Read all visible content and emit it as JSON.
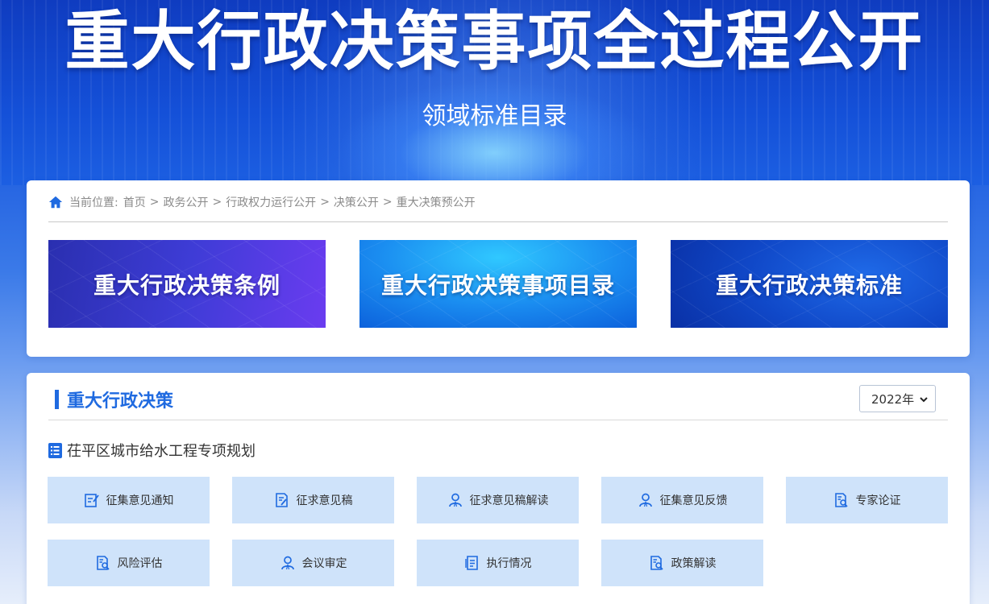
{
  "banner": {
    "title": "重大行政决策事项全过程公开",
    "subtitle": "领域标准目录"
  },
  "breadcrumb": {
    "prefix": "当前位置:",
    "items": [
      "首页",
      "政务公开",
      "行政权力运行公开",
      "决策公开",
      "重大决策预公开"
    ],
    "separator": ">"
  },
  "tiles": [
    {
      "label": "重大行政决策条例"
    },
    {
      "label": "重大行政决策事项目录"
    },
    {
      "label": "重大行政决策标准"
    }
  ],
  "section": {
    "title": "重大行政决策",
    "year_select": {
      "value": "2022年"
    },
    "item_title": "茌平区城市给水工程专项规划",
    "buttons": [
      {
        "label": "征集意见通知",
        "icon": "edit-doc-icon"
      },
      {
        "label": "征求意见稿",
        "icon": "doc-pen-icon"
      },
      {
        "label": "征求意见稿解读",
        "icon": "user-icon"
      },
      {
        "label": "征集意见反馈",
        "icon": "user-icon"
      },
      {
        "label": "专家论证",
        "icon": "doc-search-icon"
      },
      {
        "label": "风险评估",
        "icon": "doc-search-icon"
      },
      {
        "label": "会议审定",
        "icon": "user-icon"
      },
      {
        "label": "执行情况",
        "icon": "doc-list-icon"
      },
      {
        "label": "政策解读",
        "icon": "doc-search-icon"
      }
    ]
  },
  "colors": {
    "accent": "#1f6ae0",
    "button_bg": "#cfe3fa",
    "banner_blue": "#1450d8"
  }
}
